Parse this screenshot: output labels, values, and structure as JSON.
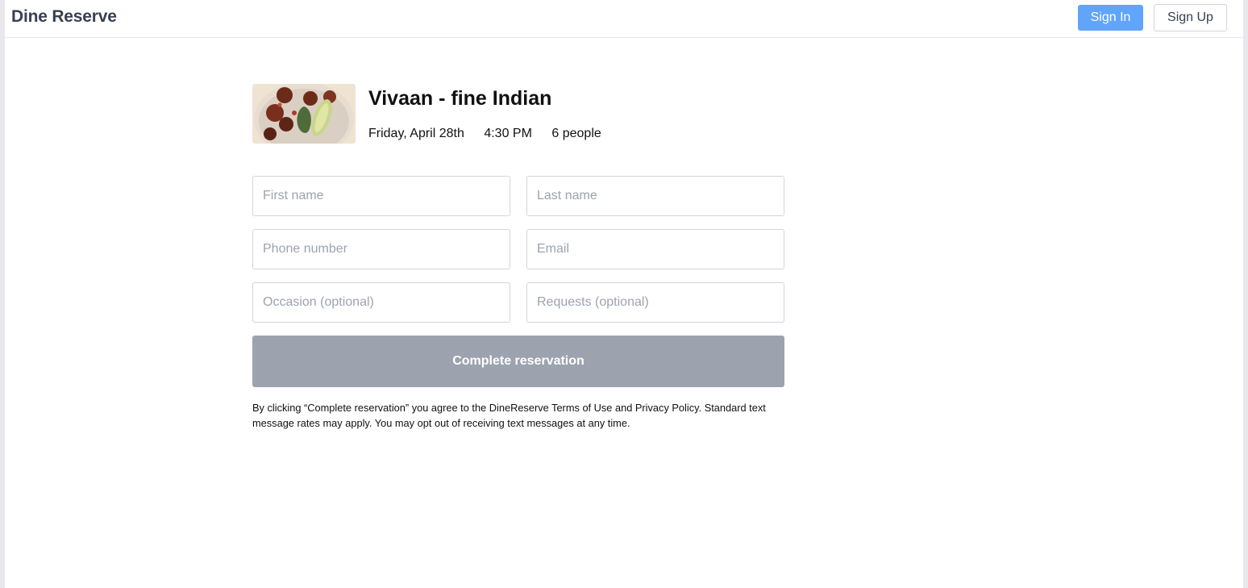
{
  "header": {
    "brand": "Dine Reserve",
    "sign_in_label": "Sign In",
    "sign_up_label": "Sign Up",
    "accent_color": "#60a5fa"
  },
  "reservation": {
    "restaurant_name": "Vivaan - fine Indian",
    "image_icon": "food-dish-photo",
    "date": "Friday, April 28th",
    "time": "4:30 PM",
    "party_size": "6 people"
  },
  "form": {
    "first_name_placeholder": "First name",
    "last_name_placeholder": "Last name",
    "phone_placeholder": "Phone number",
    "email_placeholder": "Email",
    "occasion_placeholder": "Occasion (optional)",
    "requests_placeholder": "Requests (optional)",
    "submit_label": "Complete reservation",
    "submit_color": "#9ca3af",
    "disclaimer": "By clicking “Complete reservation” you agree to the DineReserve Terms of Use and Privacy Policy. Standard text message rates may apply. You may opt out of receiving text messages at any time."
  }
}
